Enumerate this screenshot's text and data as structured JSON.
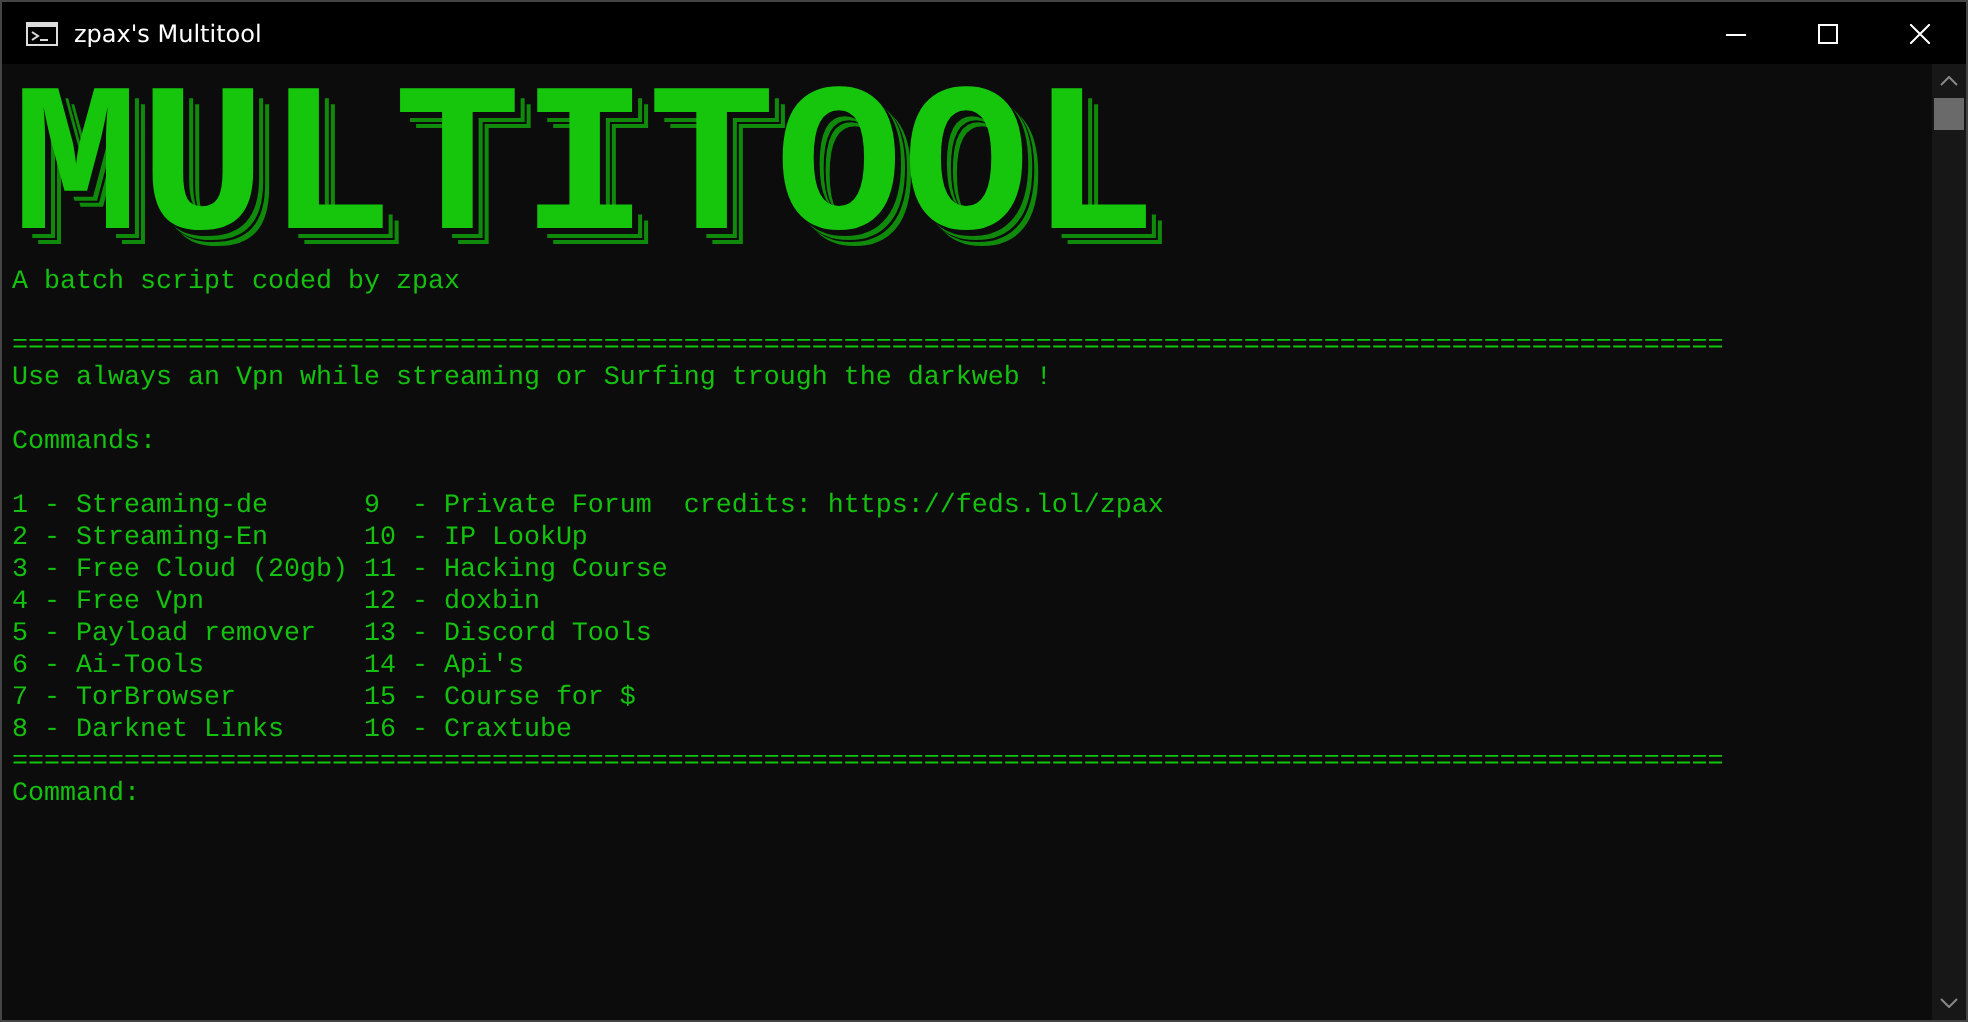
{
  "window": {
    "title": "zpax's Multitool"
  },
  "banner": {
    "text": "MULTITOOL"
  },
  "console_lines": [
    {
      "kind": "text",
      "text": "A batch script coded by zpax"
    },
    {
      "kind": "blank"
    },
    {
      "kind": "rule",
      "text": "==========================================================================================================="
    },
    {
      "kind": "text",
      "text": "Use always an Vpn while streaming or Surfing trough the darkweb !"
    },
    {
      "kind": "blank"
    },
    {
      "kind": "text",
      "text": "Commands:"
    },
    {
      "kind": "blank"
    },
    {
      "kind": "text",
      "text": "1 - Streaming-de      9  - Private Forum  credits: https://feds.lol/zpax"
    },
    {
      "kind": "text",
      "text": "2 - Streaming-En      10 - IP LookUp"
    },
    {
      "kind": "text",
      "text": "3 - Free Cloud (20gb) 11 - Hacking Course"
    },
    {
      "kind": "text",
      "text": "4 - Free Vpn          12 - doxbin"
    },
    {
      "kind": "text",
      "text": "5 - Payload remover   13 - Discord Tools"
    },
    {
      "kind": "text",
      "text": "6 - Ai-Tools          14 - Api's"
    },
    {
      "kind": "text",
      "text": "7 - TorBrowser        15 - Course for $"
    },
    {
      "kind": "text",
      "text": "8 - Darknet Links     16 - Craxtube"
    },
    {
      "kind": "rule",
      "text": "==========================================================================================================="
    },
    {
      "kind": "prompt",
      "text": "Command:"
    }
  ]
}
